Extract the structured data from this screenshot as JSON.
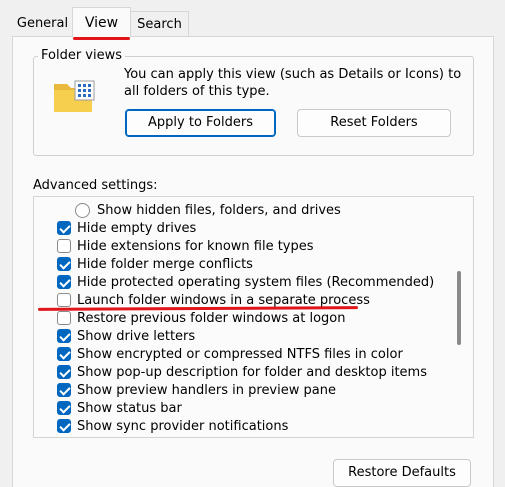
{
  "tabs": [
    {
      "label": "General"
    },
    {
      "label": "View"
    },
    {
      "label": "Search"
    }
  ],
  "folder_views": {
    "legend": "Folder views",
    "description": "You can apply this view (such as Details or Icons) to all folders of this type.",
    "apply_label": "Apply to Folders",
    "reset_label": "Reset Folders"
  },
  "advanced": {
    "label": "Advanced settings:",
    "items": [
      {
        "label": "Show hidden files, folders, and drives",
        "type": "radio",
        "checked": false
      },
      {
        "label": "Hide empty drives",
        "type": "checkbox",
        "checked": true
      },
      {
        "label": "Hide extensions for known file types",
        "type": "checkbox",
        "checked": false
      },
      {
        "label": "Hide folder merge conflicts",
        "type": "checkbox",
        "checked": true
      },
      {
        "label": "Hide protected operating system files (Recommended)",
        "type": "checkbox",
        "checked": true
      },
      {
        "label": "Launch folder windows in a separate process",
        "type": "checkbox",
        "checked": false
      },
      {
        "label": "Restore previous folder windows at logon",
        "type": "checkbox",
        "checked": false
      },
      {
        "label": "Show drive letters",
        "type": "checkbox",
        "checked": true
      },
      {
        "label": "Show encrypted or compressed NTFS files in color",
        "type": "checkbox",
        "checked": true
      },
      {
        "label": "Show pop-up description for folder and desktop items",
        "type": "checkbox",
        "checked": true
      },
      {
        "label": "Show preview handlers in preview pane",
        "type": "checkbox",
        "checked": true
      },
      {
        "label": "Show status bar",
        "type": "checkbox",
        "checked": true
      },
      {
        "label": "Show sync provider notifications",
        "type": "checkbox",
        "checked": true
      }
    ]
  },
  "restore_defaults_label": "Restore Defaults",
  "colors": {
    "accent": "#0067c0",
    "annotation_red": "#e0161a"
  }
}
